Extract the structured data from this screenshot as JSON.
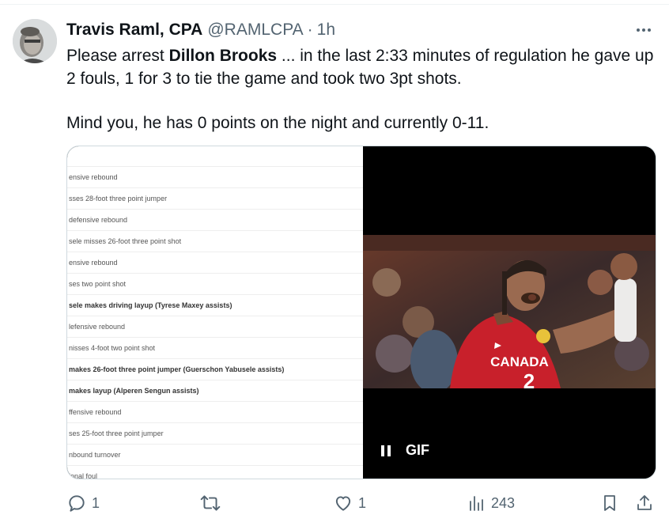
{
  "tweet": {
    "author_name": "Travis Raml, CPA",
    "handle": "@RAMLCPA",
    "separator": "·",
    "time": "1h",
    "text_before_mention": "Please arrest ",
    "mention": "Dillon Brooks",
    "text_after_mention": " ... in the last 2:33 minutes of regulation he gave up 2 fouls, 1 for 3 to tie the game and took two 3pt shots.",
    "text_second_paragraph": "Mind you, he has 0 points on the night and currently 0-11."
  },
  "media": {
    "play_by_play": [
      {
        "text": "",
        "bold": false
      },
      {
        "text": "ensive rebound",
        "bold": false
      },
      {
        "text": "sses 28-foot three point jumper",
        "bold": false
      },
      {
        "text": " defensive rebound",
        "bold": false
      },
      {
        "text": "sele misses 26-foot three point shot",
        "bold": false
      },
      {
        "text": "ensive rebound",
        "bold": false
      },
      {
        "text": "ses two point shot",
        "bold": false
      },
      {
        "text": "sele makes driving layup (Tyrese Maxey assists)",
        "bold": true
      },
      {
        "text": "lefensive rebound",
        "bold": false
      },
      {
        "text": "nisses 4-foot two point shot",
        "bold": false
      },
      {
        "text": "makes 26-foot three point jumper (Guerschon Yabusele assists)",
        "bold": true
      },
      {
        "text": " makes layup (Alperen Sengun assists)",
        "bold": true
      },
      {
        "text": "ffensive rebound",
        "bold": false
      },
      {
        "text": "ses 25-foot three point jumper",
        "bold": false
      },
      {
        "text": "nbound turnover",
        "bold": false
      },
      {
        "text": "ional foul",
        "bold": false
      }
    ],
    "jersey_text": "CANADA",
    "gif_label": "GIF",
    "pause_icon": "pause-icon"
  },
  "actions": {
    "reply_count": "1",
    "retweet_count": "",
    "like_count": "1",
    "views_count": "243"
  },
  "colors": {
    "text": "#0f1419",
    "secondary": "#536471",
    "border": "#cfd9de",
    "jersey_red": "#c8202b"
  }
}
